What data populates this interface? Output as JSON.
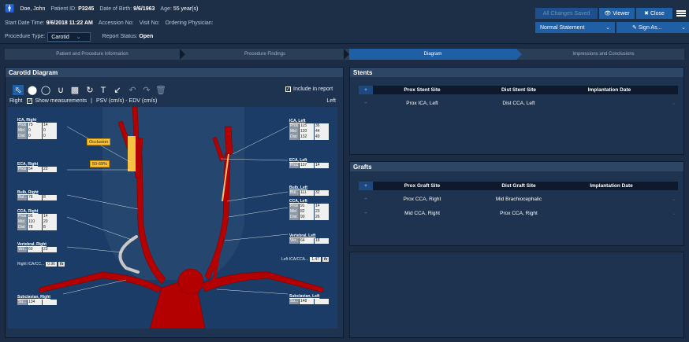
{
  "header": {
    "patient_name": "Doe, John",
    "patient_id_label": "Patient ID:",
    "patient_id": "P3245",
    "dob_label": "Date of Birth:",
    "dob": "9/6/1963",
    "age_label": "Age:",
    "age": "55 year(s)",
    "start_label": "Start Date Time:",
    "start": "9/6/2018 11:22 AM",
    "accession_label": "Accession No:",
    "visit_label": "Visit No:",
    "physician_label": "Ordering Physician:",
    "proc_type_label": "Procedure Type:",
    "proc_type": "Carotid",
    "report_status_label": "Report Status:",
    "report_status": "Open",
    "saved": "All Changes Saved",
    "viewer": "Viewer",
    "close": "Close",
    "statement": "Normal Statement",
    "sign_as": "Sign As..."
  },
  "steps": [
    "Patient and Procedure Information",
    "Procedure Findings",
    "Diagram",
    "Impressions and Conclusions"
  ],
  "diagram": {
    "title": "Carotid Diagram",
    "include_label": "Include in report",
    "right_label": "Right",
    "show_measurements": "Show measurements",
    "units": "PSV (cm/s) - EDV (cm/s)",
    "left_label": "Left",
    "occlusion": "Occlusion",
    "stenosis": "50-69%",
    "ratio_right_label": "Right ICA/CC...",
    "ratio_right": "0.96",
    "ratio_left_label": "Left ICA/CCA...",
    "ratio_left": "1.47",
    "fx": "fx",
    "groups": [
      {
        "title": "ICA, Right",
        "rows": [
          [
            "Prox",
            "75",
            "14"
          ],
          [
            "Mid",
            "0",
            "0"
          ],
          [
            "Dist",
            "0",
            "0"
          ]
        ]
      },
      {
        "title": "ECA, Right",
        "rows": [
          [
            "Prox",
            "54",
            "22"
          ]
        ]
      },
      {
        "title": "Bulb, Right",
        "rows": [
          [
            "Bul...",
            "78",
            "8"
          ]
        ]
      },
      {
        "title": "CCA, Right",
        "rows": [
          [
            "Prox",
            "95",
            "14"
          ],
          [
            "Mid",
            "110",
            "20"
          ],
          [
            "Dist",
            "78",
            "8"
          ]
        ]
      },
      {
        "title": "Vertebral, Right",
        "rows": [
          [
            "Ver...",
            "60",
            "23"
          ]
        ]
      },
      {
        "title": "Subclavian, Right",
        "rows": [
          [
            "Su...",
            "134",
            ""
          ]
        ]
      },
      {
        "title": "ICA, Left",
        "rows": [
          [
            "Prox",
            "115",
            "36"
          ],
          [
            "Mid",
            "120",
            "44"
          ],
          [
            "Dist",
            "132",
            "49"
          ]
        ]
      },
      {
        "title": "ECA, Left",
        "rows": [
          [
            "Prox",
            "137",
            "14"
          ]
        ]
      },
      {
        "title": "Bulb, Left",
        "rows": [
          [
            "Bul...",
            "111",
            "32"
          ]
        ]
      },
      {
        "title": "CCA, Left",
        "rows": [
          [
            "Prox",
            "91",
            "14"
          ],
          [
            "Mid",
            "82",
            "23"
          ],
          [
            "Dist",
            "90",
            "26"
          ]
        ]
      },
      {
        "title": "Vertebral, Left",
        "rows": [
          [
            "Ver...",
            "64",
            "18"
          ]
        ]
      },
      {
        "title": "Subclavian, Left",
        "rows": [
          [
            "Su...",
            "148",
            ""
          ]
        ]
      }
    ]
  },
  "stents": {
    "title": "Stents",
    "headers": [
      "Prox Stent Site",
      "Dist Stent Site",
      "Implantation Date"
    ],
    "rows": [
      [
        "Prox ICA, Left",
        "Dist CCA, Left",
        ""
      ]
    ]
  },
  "grafts": {
    "title": "Grafts",
    "headers": [
      "Prox Graft Site",
      "Dist Graft Site",
      "Implantation Date"
    ],
    "rows": [
      [
        "Prox CCA, Right",
        "Mid Brachiocephalic",
        ""
      ],
      [
        "Mid CCA, Right",
        "Prox CCA, Right",
        ""
      ]
    ]
  },
  "colors": {
    "accent": "#1f5fa6",
    "artery": "#b00000",
    "tag": "#f7c242"
  }
}
